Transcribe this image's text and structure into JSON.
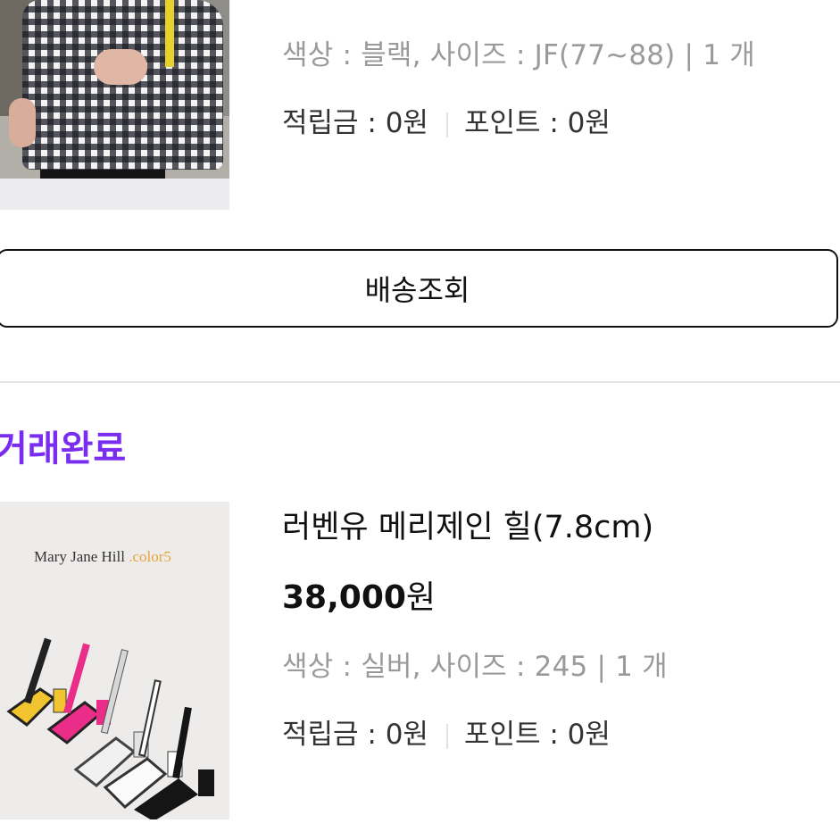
{
  "order1": {
    "options": "색상 : 블랙, 사이즈 : JF(77~88) | 1 개",
    "reward": "적립금 : 0원",
    "point": "포인트 : 0원"
  },
  "track_button": "배송조회",
  "order2": {
    "status": "거래완료",
    "image_caption_main": "Mary Jane Hill ",
    "image_caption_accent": ".color5",
    "title": "러벤유 메리제인 힐(7.8cm)",
    "price": "38,000",
    "price_unit": "원",
    "options": "색상 : 실버, 사이즈 : 245 | 1 개",
    "reward": "적립금 : 0원",
    "point": "포인트 : 0원"
  },
  "colors": {
    "status_purple": "#7a2cf0",
    "muted_text": "#9a9a9a"
  }
}
